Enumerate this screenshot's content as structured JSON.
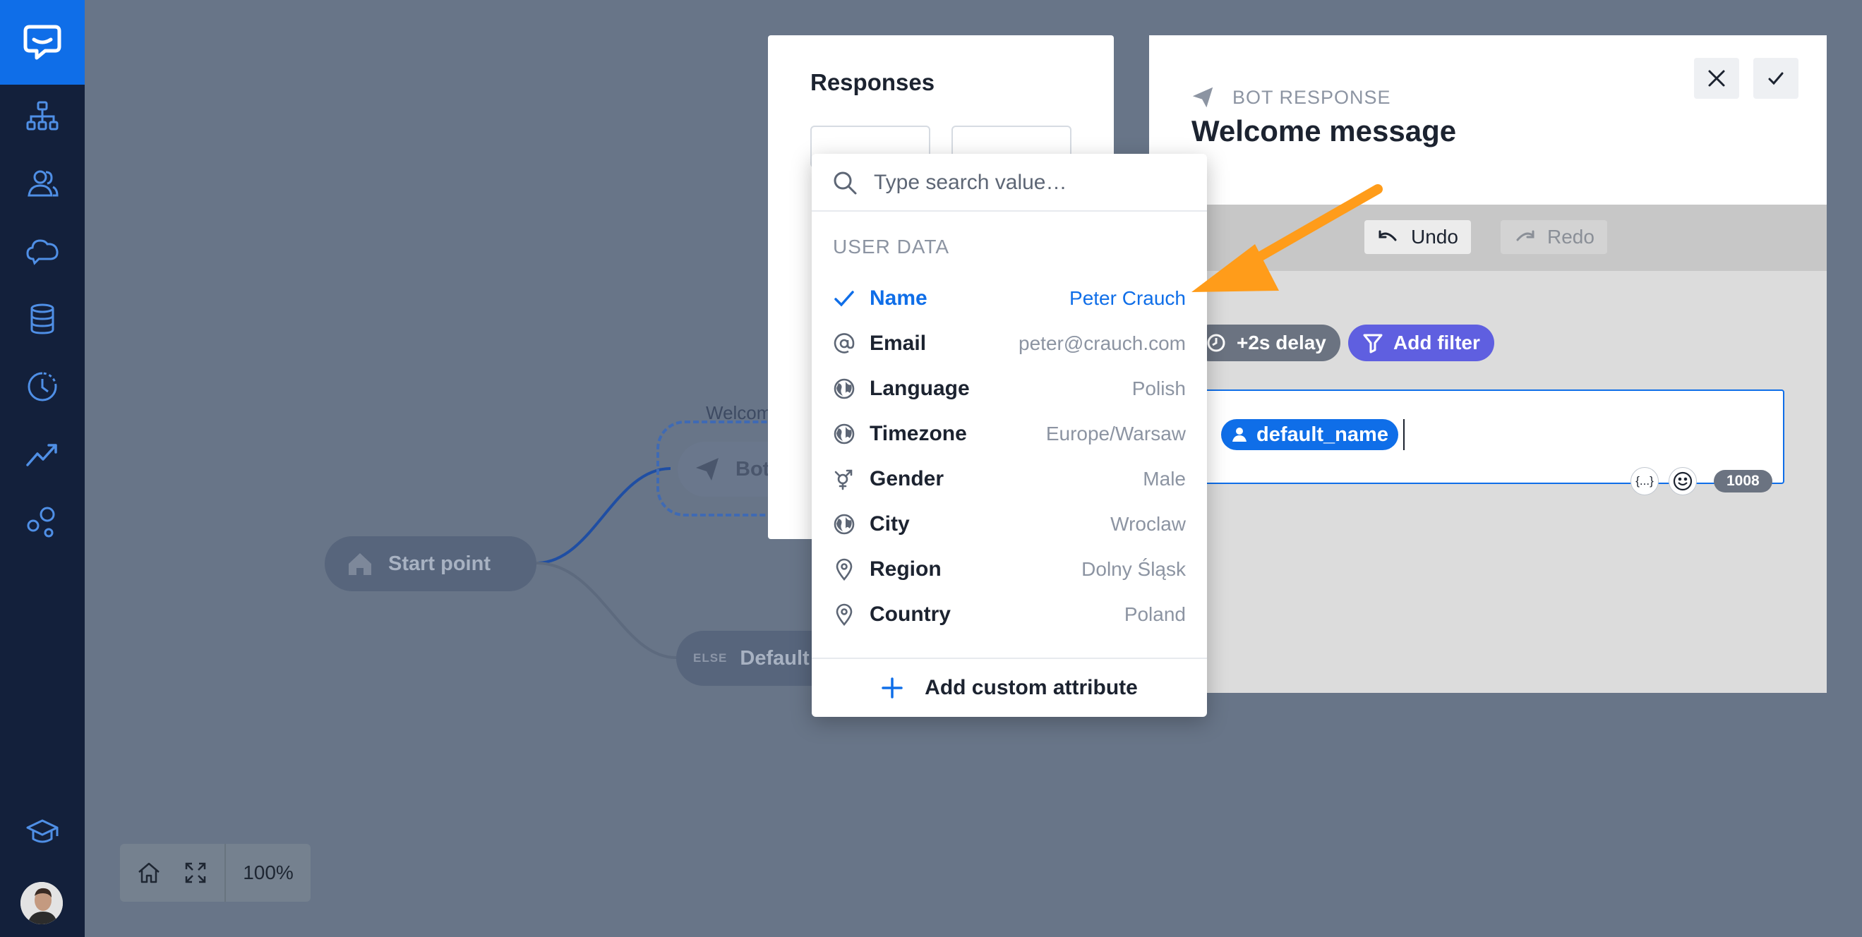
{
  "colors": {
    "accent": "#0f6ee8",
    "sidebar": "#13203b",
    "canvas": "#687588",
    "annotation_arrow": "#ff9c1a",
    "filter_pill": "#5f5fe0"
  },
  "sidebar": {
    "items": [
      {
        "icon": "sitemap-icon"
      },
      {
        "icon": "users-icon"
      },
      {
        "icon": "chat-cloud-icon"
      },
      {
        "icon": "database-icon"
      },
      {
        "icon": "history-icon"
      },
      {
        "icon": "analytics-icon"
      },
      {
        "icon": "integrations-icon"
      },
      {
        "icon": "academy-icon"
      }
    ]
  },
  "canvas": {
    "start_node": "Start point",
    "bot_group_label": "Welcom",
    "bot_node": "Bot",
    "default_tag": "ELSE",
    "default_node": "Default",
    "zoom": "100%"
  },
  "responses_panel": {
    "title": "Responses"
  },
  "bot_panel": {
    "kind": "BOT RESPONSE",
    "name": "Welcome message",
    "undo": "Undo",
    "redo": "Redo",
    "delay": "+2s delay",
    "add_filter": "Add filter",
    "variable_chip": "default_name",
    "variable_picker": "{...}",
    "char_count": "1008"
  },
  "dropdown": {
    "search_placeholder": "Type search value…",
    "section": "USER DATA",
    "options": [
      {
        "label": "Name",
        "value": "Peter Crauch",
        "icon": "check-icon",
        "selected": true
      },
      {
        "label": "Email",
        "value": "peter@crauch.com",
        "icon": "at-icon"
      },
      {
        "label": "Language",
        "value": "Polish",
        "icon": "globe-icon"
      },
      {
        "label": "Timezone",
        "value": "Europe/Warsaw",
        "icon": "globe-icon"
      },
      {
        "label": "Gender",
        "value": "Male",
        "icon": "gender-icon"
      },
      {
        "label": "City",
        "value": "Wroclaw",
        "icon": "globe-icon"
      },
      {
        "label": "Region",
        "value": "Dolny Śląsk",
        "icon": "pin-icon"
      },
      {
        "label": "Country",
        "value": "Poland",
        "icon": "pin-icon"
      }
    ],
    "add_custom": "Add custom attribute"
  }
}
